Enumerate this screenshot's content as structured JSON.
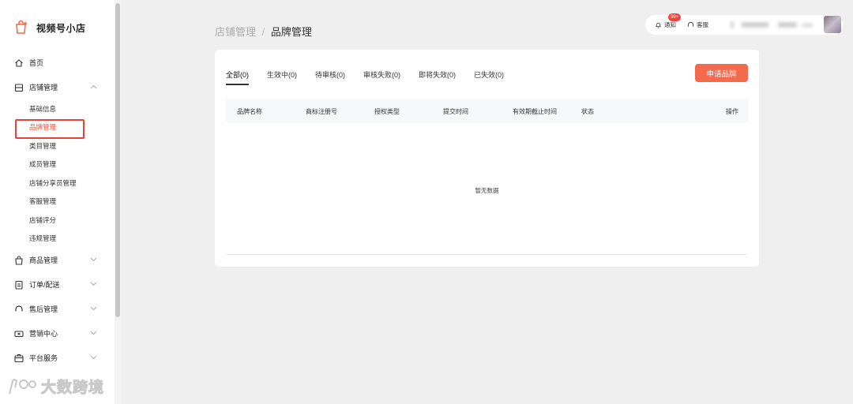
{
  "brand": {
    "name": "视频号小店",
    "icon": "shop-bag-icon",
    "color": "#f46a4d"
  },
  "sidebar": {
    "groups": [
      {
        "label": "首页",
        "icon": "home-icon"
      },
      {
        "label": "店铺管理",
        "icon": "store-icon",
        "expanded": true,
        "items": [
          "基础信息",
          "品牌管理",
          "类目管理",
          "成员管理",
          "店铺分享员管理",
          "客服管理",
          "店铺评分",
          "违规管理"
        ],
        "active_item": "品牌管理"
      },
      {
        "label": "商品管理",
        "icon": "bag-icon"
      },
      {
        "label": "订单/配送",
        "icon": "order-icon"
      },
      {
        "label": "售后管理",
        "icon": "headset-icon"
      },
      {
        "label": "营销中心",
        "icon": "ticket-icon"
      },
      {
        "label": "平台服务",
        "icon": "service-box-icon"
      }
    ]
  },
  "watermark_logo": {
    "text": "大数跨境"
  },
  "breadcrumb": {
    "parent": "店铺管理",
    "separator": "/",
    "current": "品牌管理"
  },
  "topbar": {
    "notice_label": "通知",
    "notice_badge": "99+",
    "service_label": "客服"
  },
  "tabs": [
    "全部(0)",
    "生效中(0)",
    "待审核(0)",
    "审核失败(0)",
    "即将失效(0)",
    "已失效(0)"
  ],
  "active_tab": "全部(0)",
  "apply_button": "申请品牌",
  "table": {
    "columns": [
      "品牌名称",
      "商标注册号",
      "授权类型",
      "提交时间",
      "有效期截止时间",
      "状态",
      "操作"
    ],
    "empty_text": "暂无数据"
  },
  "colors": {
    "accent": "#f46a4d",
    "active_border": "#e4443c",
    "badge": "#f0443c"
  }
}
